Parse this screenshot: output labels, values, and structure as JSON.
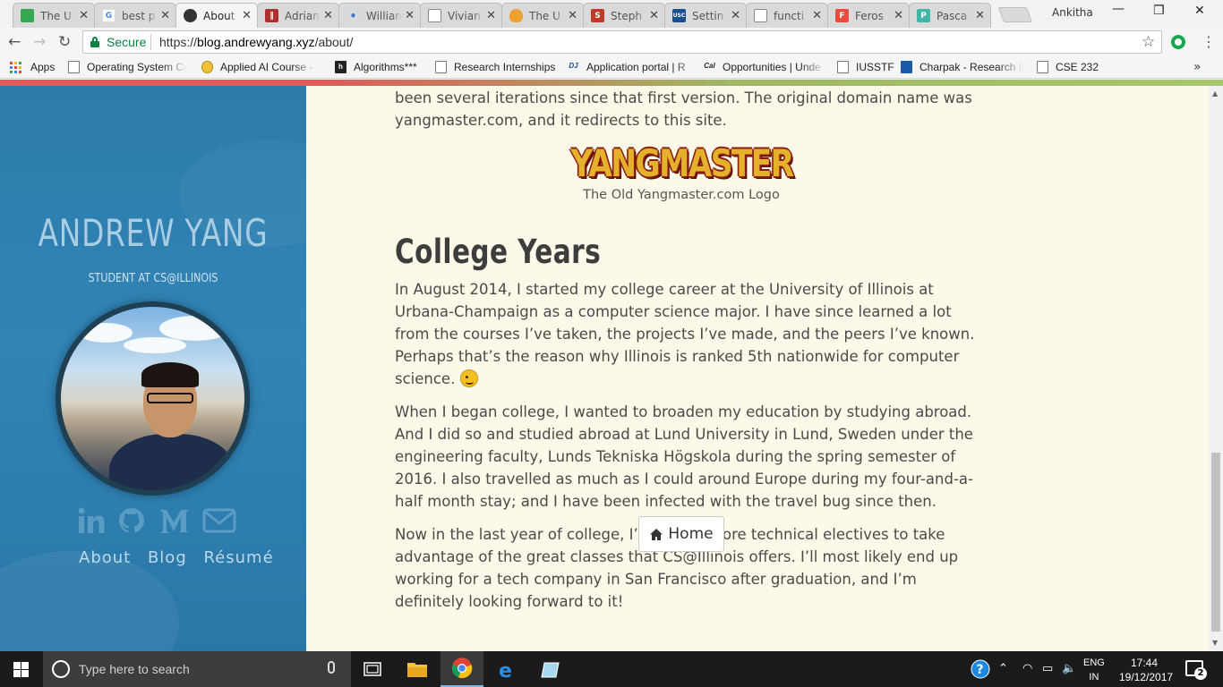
{
  "browser": {
    "tabs": [
      {
        "title": "The U",
        "favicon": "green-slides-icon",
        "color": "#36a852",
        "active": false
      },
      {
        "title": "best p",
        "favicon": "google-icon",
        "color": "#4285f4",
        "active": false
      },
      {
        "title": "About",
        "favicon": "site-globe-icon",
        "color": "#333333",
        "active": true
      },
      {
        "title": "Adrian",
        "favicon": "bars-icon",
        "color": "#b03030",
        "active": false
      },
      {
        "title": "William",
        "favicon": "dot-icon",
        "color": "#3a6fd8",
        "active": false
      },
      {
        "title": "Vivian",
        "favicon": "page-icon",
        "color": "#888888",
        "active": false
      },
      {
        "title": "The U",
        "favicon": "cloud-icon",
        "color": "#f0a030",
        "active": false
      },
      {
        "title": "Steph",
        "favicon": "s-logo-icon",
        "color": "#c0392b",
        "active": false
      },
      {
        "title": "Settin",
        "favicon": "usc-icon",
        "color": "#1a4f8b",
        "active": false
      },
      {
        "title": "functi",
        "favicon": "page-icon",
        "color": "#888888",
        "active": false
      },
      {
        "title": "Feros",
        "favicon": "f-logo-icon",
        "color": "#e74c3c",
        "active": false
      },
      {
        "title": "Pasca",
        "favicon": "p-logo-icon",
        "color": "#3fb6a8",
        "active": false
      }
    ],
    "profile_name": "Ankitha",
    "security_label": "Secure",
    "url_scheme": "https://",
    "url_host": "blog.andrewyang.xyz",
    "url_path": "/about/",
    "bookmarks": [
      {
        "label": "Apps",
        "icon": "apps-grid-icon"
      },
      {
        "label": "Operating System Co",
        "icon": "page-icon"
      },
      {
        "label": "Applied AI Course - I",
        "icon": "ai-badge-icon"
      },
      {
        "label": "Algorithms***",
        "icon": "h-logo-icon"
      },
      {
        "label": "Research Internships",
        "icon": "page-icon"
      },
      {
        "label": "Application portal | R",
        "icon": "dj-logo-icon"
      },
      {
        "label": "Opportunities | Unde",
        "icon": "cal-logo-icon"
      },
      {
        "label": "IUSSTF",
        "icon": "page-icon"
      },
      {
        "label": "Charpak - Research Ir",
        "icon": "charpak-icon"
      },
      {
        "label": "CSE 232",
        "icon": "page-icon"
      }
    ]
  },
  "sidebar": {
    "name": "ANDREW YANG",
    "tagline": "STUDENT AT CS@ILLINOIS",
    "social": [
      "linkedin-icon",
      "github-icon",
      "medium-icon",
      "email-icon"
    ],
    "nav": [
      {
        "label": "About"
      },
      {
        "label": "Blog"
      },
      {
        "label": "Résumé"
      }
    ]
  },
  "article": {
    "intro": "been several iterations since that first version. The original domain name was yangmaster.com, and it redirects to this site.",
    "logo_text": "YANGMASTER",
    "logo_caption": "The Old Yangmaster.com Logo",
    "heading": "College Years",
    "paragraphs": [
      "In August 2014, I started my college career at the University of Illinois at Urbana-Champaign as a computer science major. I have since learned a lot from the courses I’ve taken, the projects I’ve made, and the peers I’ve known. Perhaps that’s the reason why Illinois is ranked 5th nationwide for computer science.",
      "When I began college, I wanted to broaden my education by studying abroad. And I did so and studied abroad at Lund University in Lund, Sweden under the engineering faculty, Lunds Tekniska Högskola during the spring semester of 2016. I also travelled as much as I could around Europe during my four-and-a-half month stay; and I have been infected with the travel bug since then.",
      "Now in the last year of college, I’m taking more technical electives to take advantage of the great classes that CS@Illinois offers. I’ll most likely end up working for a tech company in San Francisco after graduation, and I’m definitely looking forward to it!"
    ],
    "home_button": "Home"
  },
  "taskbar": {
    "search_placeholder": "Type here to search",
    "apps": [
      "task-view-icon",
      "file-explorer-icon",
      "chrome-icon",
      "edge-icon",
      "notepad-icon"
    ],
    "lang_top": "ENG",
    "lang_bottom": "IN",
    "time": "17:44",
    "date": "19/12/2017",
    "notification_count": "2"
  },
  "colors": {
    "sidebar_blue": "#3084b6",
    "page_bg": "#fdf9e8",
    "secure_green": "#0b8043"
  }
}
